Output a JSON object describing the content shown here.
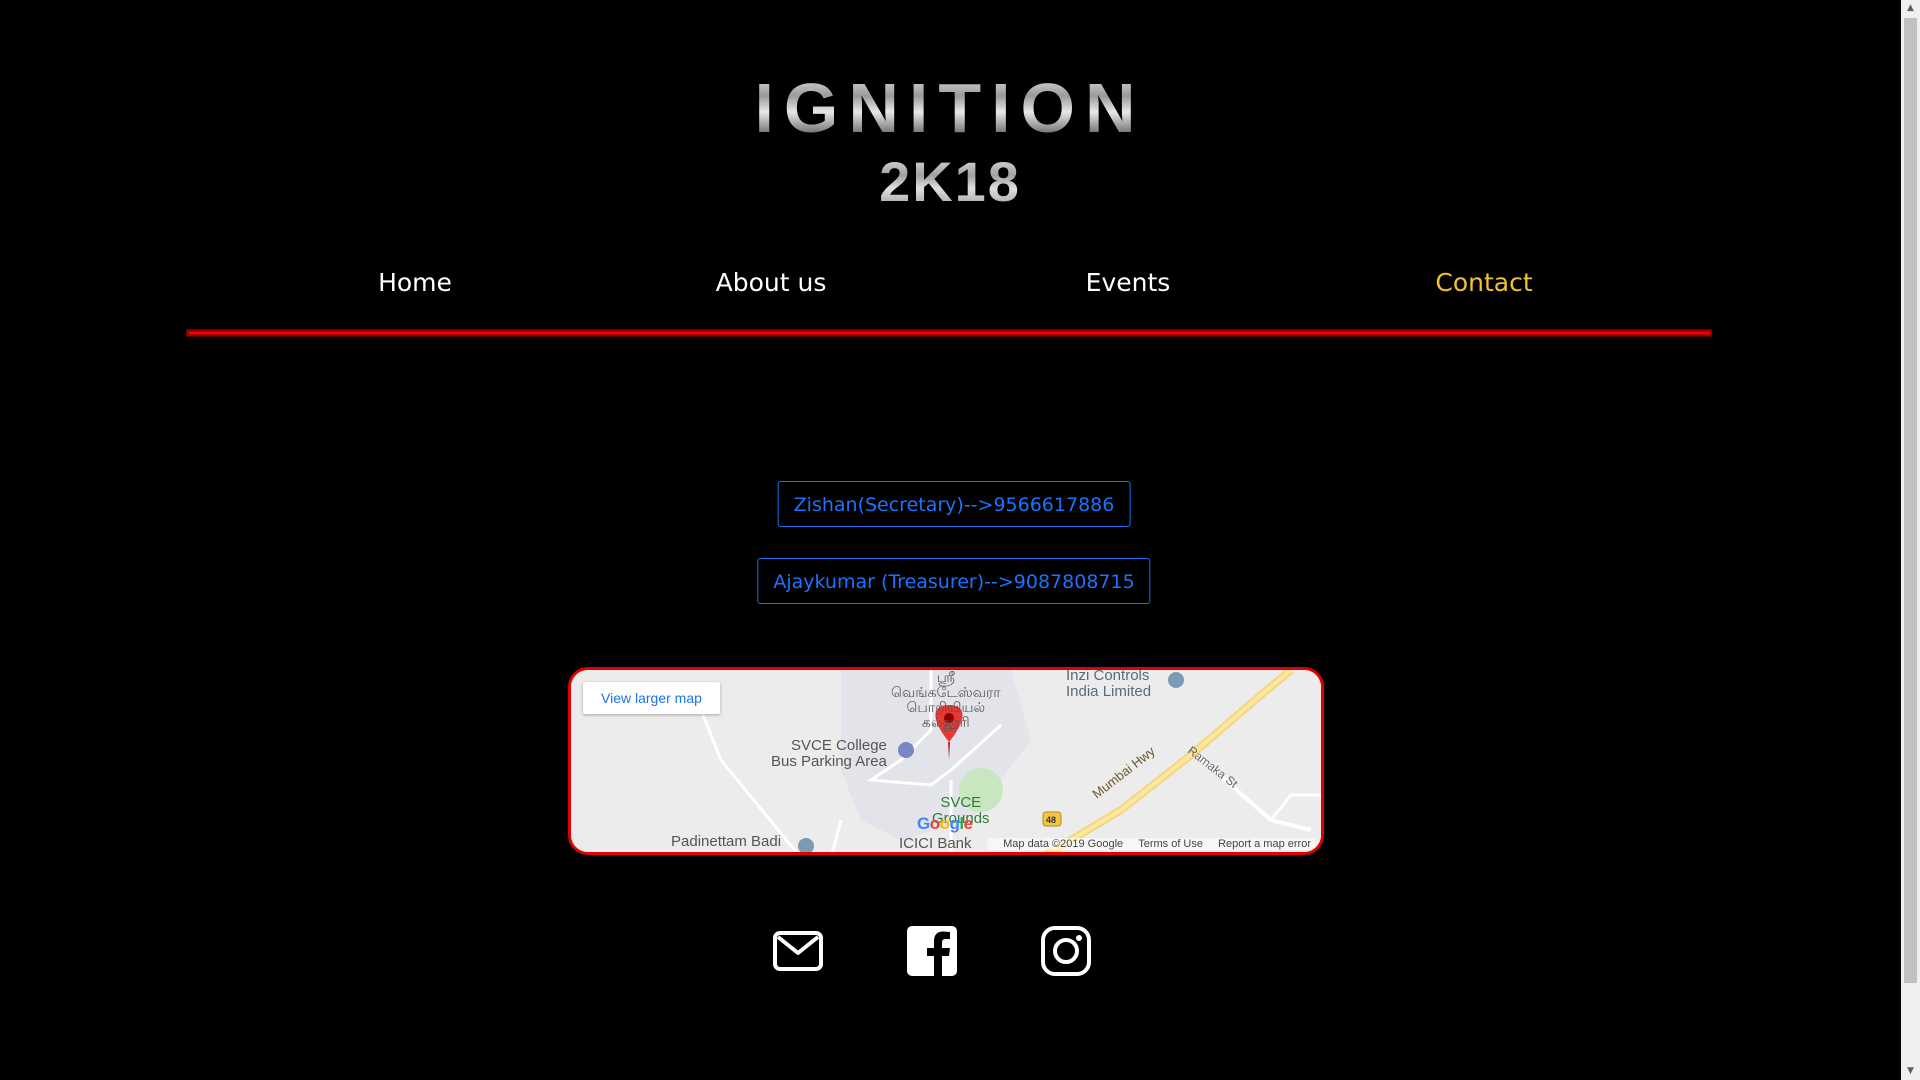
{
  "logo": {
    "line1": "IGNITION",
    "line2": "2K18"
  },
  "nav": {
    "items": [
      {
        "label": "Home"
      },
      {
        "label": "About us"
      },
      {
        "label": "Events"
      },
      {
        "label": "Contact"
      }
    ],
    "active": "Contact"
  },
  "contacts": [
    {
      "label": "Zishan(Secretary)-->9566617886"
    },
    {
      "label": "Ajaykumar (Treasurer)-->9087808715"
    }
  ],
  "map": {
    "view_larger": "View larger map",
    "labels": {
      "inzi": "Inzi Controls\nIndia Limited",
      "svce_parking": "SVCE College\nBus Parking Area",
      "svce_grounds": "SVCE\nGrounds",
      "padinettam": "Padinettam Badi",
      "icici": "ICICI Bank",
      "mumbai_hwy": "Mumbai Hwy",
      "ramaka": "Ramaka St",
      "tamil": "ஸ்ரீ\nவெங்கடேஸ்வரா\nபொறியியல்\nகல்லூரி",
      "route": "48"
    },
    "footer": {
      "map_data": "Map data ©2019 Google",
      "terms": "Terms of Use",
      "report": "Report a map error"
    },
    "google_logo": "Google"
  },
  "social": {
    "icons": [
      "mail-icon",
      "facebook-icon",
      "instagram-icon"
    ]
  },
  "colors": {
    "background": "#000000",
    "nav_active": "#f2c12e",
    "accent_line": "#ff0000",
    "button_blue": "#1a73ff"
  }
}
